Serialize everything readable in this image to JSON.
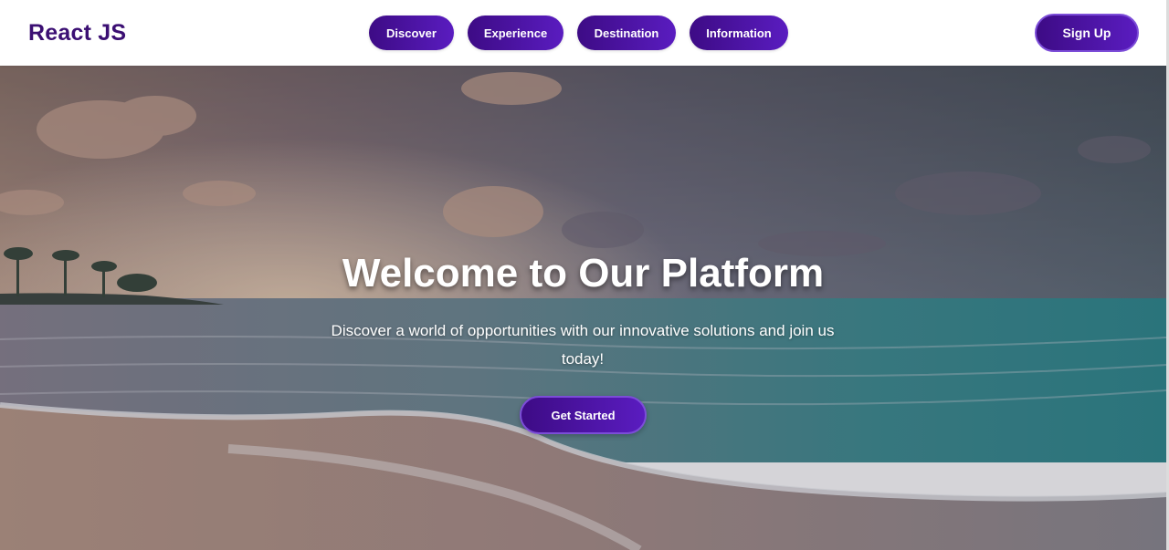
{
  "header": {
    "logo": "React JS",
    "nav": [
      "Discover",
      "Experience",
      "Destination",
      "Information"
    ],
    "signup_label": "Sign Up"
  },
  "hero": {
    "title": "Welcome to Our Platform",
    "subtitle": "Discover a world of opportunities with our innovative solutions and join us today!",
    "cta_label": "Get Started"
  },
  "colors": {
    "brand": "#3b0f73",
    "button_gradient_start": "#3d0b85",
    "button_gradient_end": "#5a1cc0"
  }
}
